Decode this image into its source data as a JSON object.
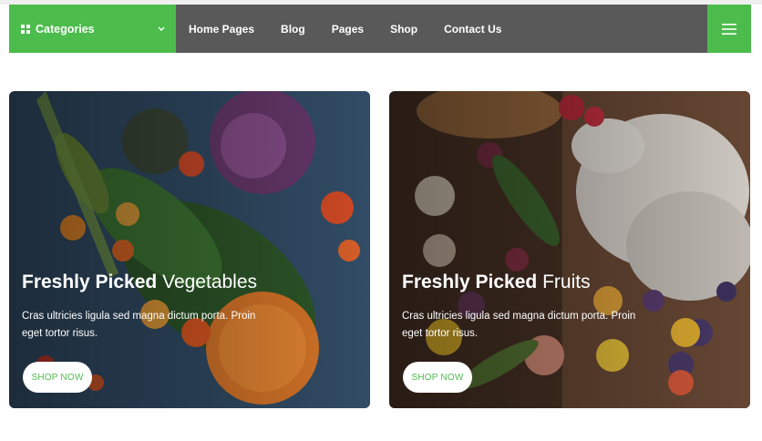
{
  "colors": {
    "accent": "#4cbc4c",
    "navbar": "#595959",
    "button_text": "#4fba4f"
  },
  "nav": {
    "categories_label": "Categories",
    "categories_icon": "grid-icon",
    "menu": [
      {
        "label": "Home Pages"
      },
      {
        "label": "Blog"
      },
      {
        "label": "Pages"
      },
      {
        "label": "Shop"
      },
      {
        "label": "Contact Us"
      }
    ],
    "hamburger_icon": "hamburger-menu-icon"
  },
  "banners": [
    {
      "title_bold": "Freshly Picked",
      "title_light": "Vegetables",
      "text": "Cras ultricies ligula sed magna dictum porta. Proin eget tortor risus.",
      "button": "SHOP NOW"
    },
    {
      "title_bold": "Freshly Picked",
      "title_light": "Fruits",
      "text": "Cras ultricies ligula sed magna dictum porta. Proin eget tortor risus.",
      "button": "SHOP NOW"
    }
  ]
}
